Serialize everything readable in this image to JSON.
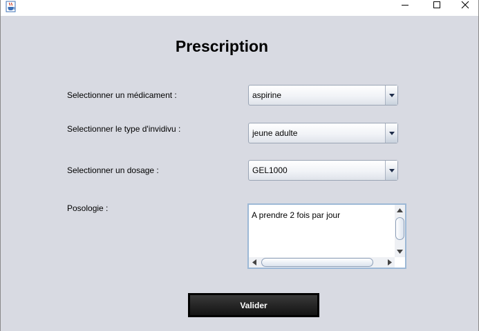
{
  "window": {
    "app_icon": "java-cup-icon",
    "controls": [
      "minimize-icon",
      "maximize-icon",
      "close-icon"
    ]
  },
  "form": {
    "title": "Prescription",
    "medicament": {
      "label": "Selectionner un médicament :",
      "value": "aspirine"
    },
    "individu": {
      "label": "Selectionner le type d'invidivu :",
      "value": "jeune adulte"
    },
    "dosage": {
      "label": "Selectionner un dosage :",
      "value": "GEL1000"
    },
    "posologie": {
      "label": "Posologie :",
      "value": "A prendre 2 fois par jour"
    },
    "submit_label": "Valider"
  },
  "colors": {
    "window_background": "#d8dae2",
    "button_background": "#262626",
    "combo_border": "#9aa4b4",
    "textarea_border": "#9cb8d6"
  }
}
